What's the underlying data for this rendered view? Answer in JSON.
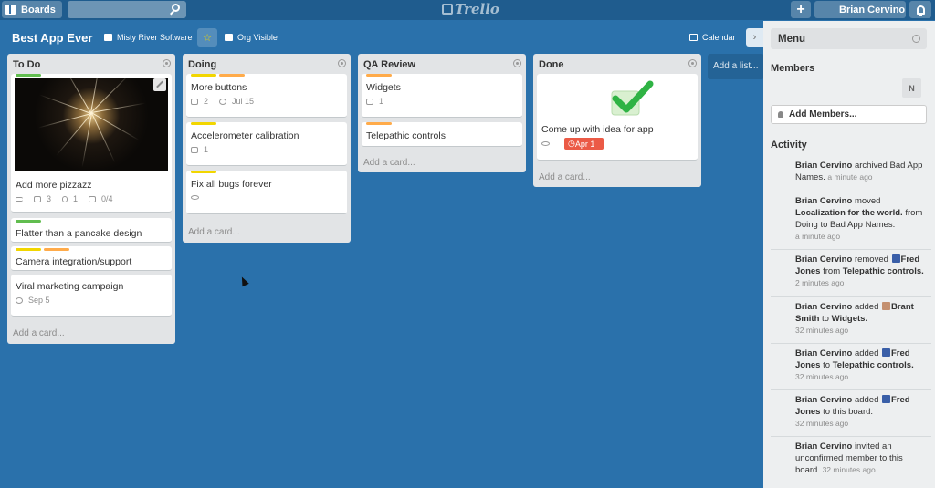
{
  "topbar": {
    "boards_label": "Boards",
    "search_placeholder": "",
    "logo": "Trello",
    "add_label": "+",
    "user_name": "Brian Cervino"
  },
  "board": {
    "title": "Best App Ever",
    "org": "Misty River Software",
    "visibility": "Org Visible",
    "calendar": "Calendar",
    "star": "☆",
    "panel_toggle": "›"
  },
  "lists": {
    "todo": {
      "title": "To Do",
      "add_card": "Add a card...",
      "cards": [
        {
          "title": "Add more pizzazz",
          "comments": "3",
          "attachments": "1",
          "checklist": "0/4"
        },
        {
          "title": "Flatter than a pancake design"
        },
        {
          "title": "Camera integration/support"
        },
        {
          "title": "Viral marketing campaign",
          "due": "Sep 5"
        }
      ]
    },
    "doing": {
      "title": "Doing",
      "add_card": "Add a card...",
      "cards": [
        {
          "title": "More buttons",
          "comments": "2",
          "due": "Jul 15"
        },
        {
          "title": "Accelerometer calibration",
          "comments": "1"
        },
        {
          "title": "Fix all bugs forever"
        }
      ]
    },
    "qa": {
      "title": "QA Review",
      "add_card": "Add a card...",
      "cards": [
        {
          "title": "Widgets",
          "comments": "1"
        },
        {
          "title": "Telepathic controls"
        }
      ]
    },
    "done": {
      "title": "Done",
      "add_card": "Add a card...",
      "cards": [
        {
          "title": "Come up with idea for app",
          "due": "Apr 1"
        }
      ]
    }
  },
  "add_list": "Add a list...",
  "label_colors": {
    "green": "#61bd4f",
    "yellow": "#f2d600",
    "orange": "#ffab4a",
    "red": "#eb5a46"
  },
  "sidebar": {
    "title": "Menu",
    "members_title": "Members",
    "member_initial": "N",
    "add_members": "Add Members...",
    "activity_title": "Activity",
    "activity": [
      {
        "user": "Brian Cervino",
        "action": "archived",
        "obj1": "Bad App Names.",
        "when": "a minute ago"
      },
      {
        "user": "Brian Cervino",
        "action": "moved",
        "obj1": "Localization for the world.",
        "rest": "from Doing to Bad App Names.",
        "when": "a minute ago"
      },
      {
        "user": "Brian Cervino",
        "action": "removed",
        "obj1": "Fred Jones",
        "mid": "from",
        "obj2": "Telepathic controls.",
        "when": "2 minutes ago"
      },
      {
        "user": "Brian Cervino",
        "action": "added",
        "obj1": "Brant Smith",
        "mid": "to",
        "obj2": "Widgets.",
        "when": "32 minutes ago"
      },
      {
        "user": "Brian Cervino",
        "action": "added",
        "obj1": "Fred Jones",
        "mid": "to",
        "obj2": "Telepathic controls.",
        "when": "32 minutes ago"
      },
      {
        "user": "Brian Cervino",
        "action": "added",
        "obj1": "Fred Jones",
        "rest": "to this board.",
        "when": "32 minutes ago"
      },
      {
        "user": "Brian Cervino",
        "action": "invited an unconfirmed member to this board.",
        "when": "32 minutes ago"
      }
    ]
  }
}
